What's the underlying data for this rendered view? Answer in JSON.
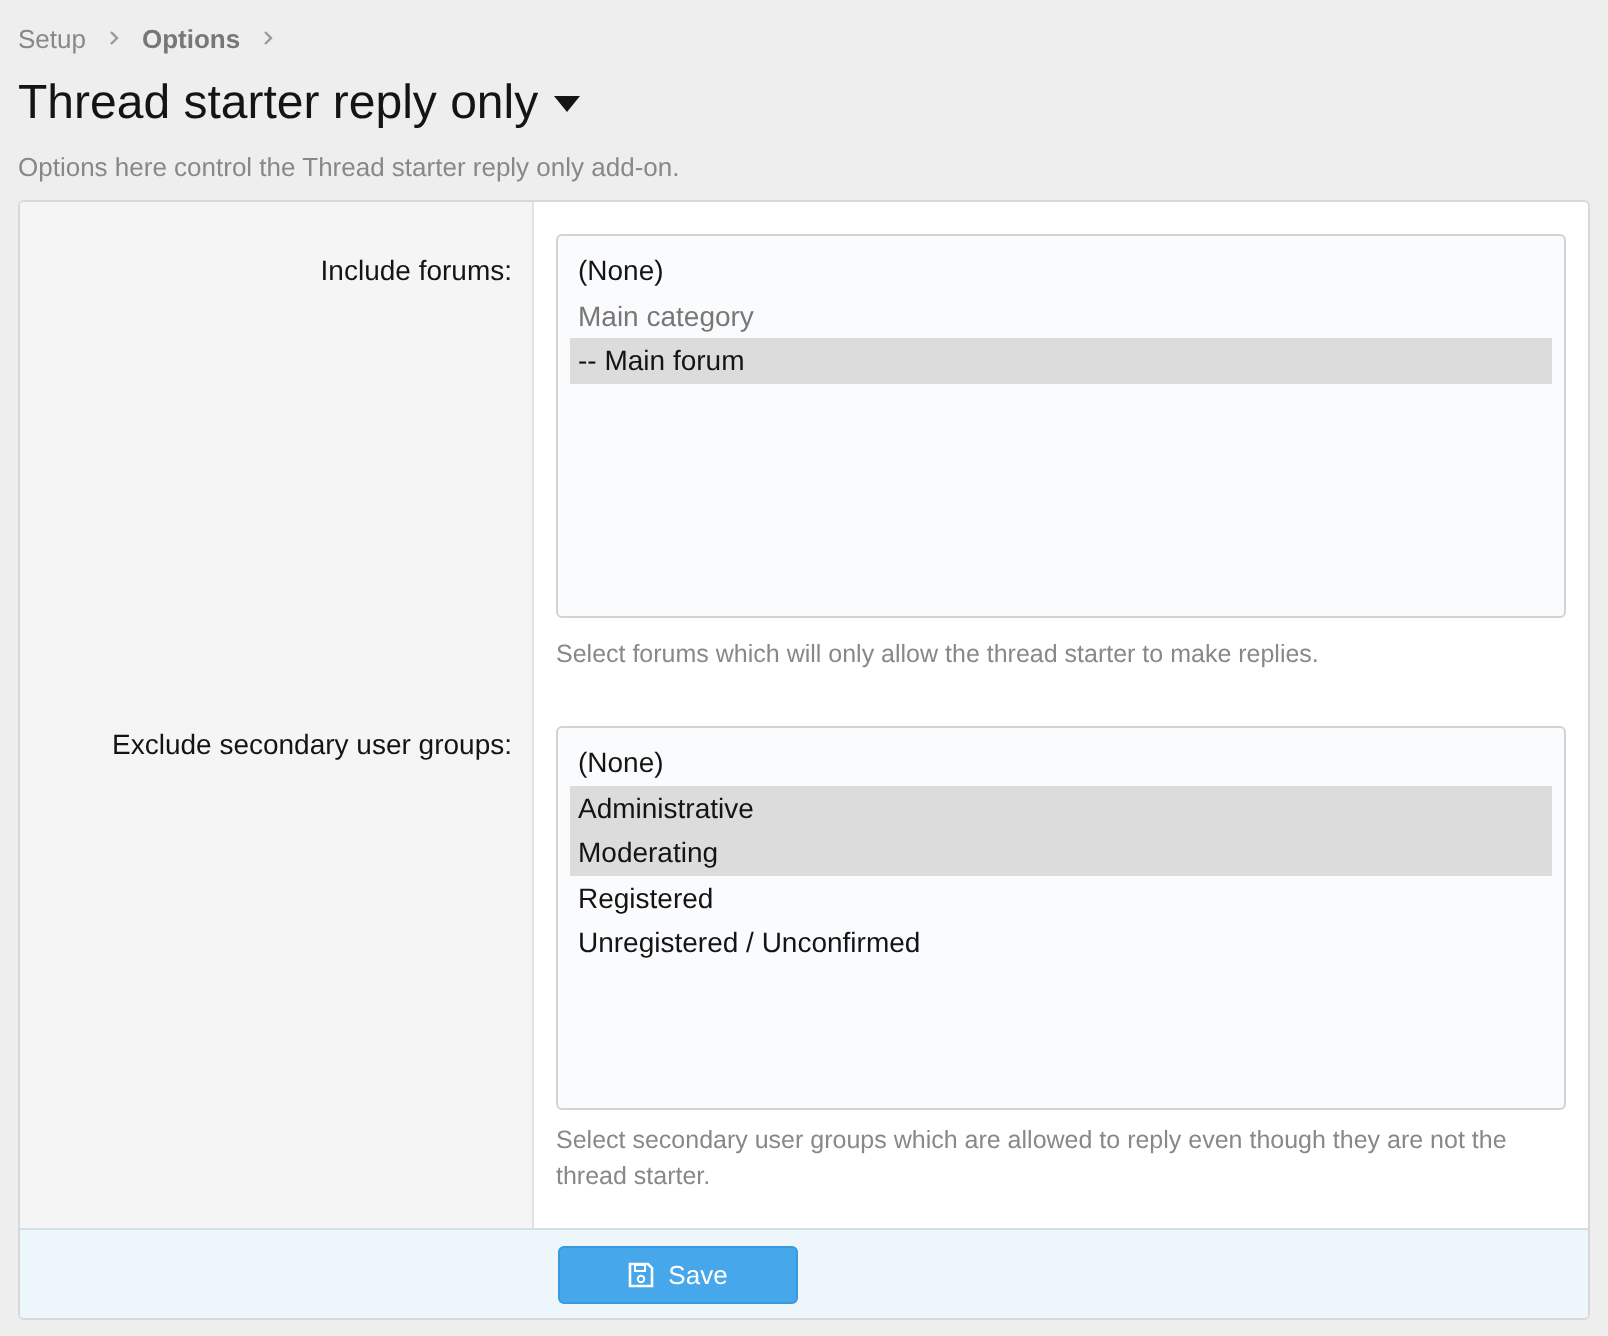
{
  "breadcrumb": [
    {
      "label": "Setup",
      "current": false
    },
    {
      "label": "Options",
      "current": true
    }
  ],
  "title": "Thread starter reply only",
  "description": "Options here control the Thread starter reply only add-on.",
  "rows": [
    {
      "label": "Include forums:",
      "options": [
        {
          "label": "(None)",
          "selected": false,
          "disabled": false
        },
        {
          "label": "Main category",
          "selected": false,
          "disabled": true
        },
        {
          "label": "-- Main forum",
          "selected": true,
          "disabled": false
        }
      ],
      "hint": "Select forums which will only allow the thread starter to make replies."
    },
    {
      "label": "Exclude secondary user groups:",
      "options": [
        {
          "label": "(None)",
          "selected": false,
          "disabled": false
        },
        {
          "label": "Administrative",
          "selected": true,
          "disabled": false
        },
        {
          "label": "Moderating",
          "selected": true,
          "disabled": false
        },
        {
          "label": "Registered",
          "selected": false,
          "disabled": false
        },
        {
          "label": "Unregistered / Unconfirmed",
          "selected": false,
          "disabled": false
        }
      ],
      "hint": "Select secondary user groups which are allowed to reply even though they are not the thread starter."
    }
  ],
  "save_button": "Save"
}
